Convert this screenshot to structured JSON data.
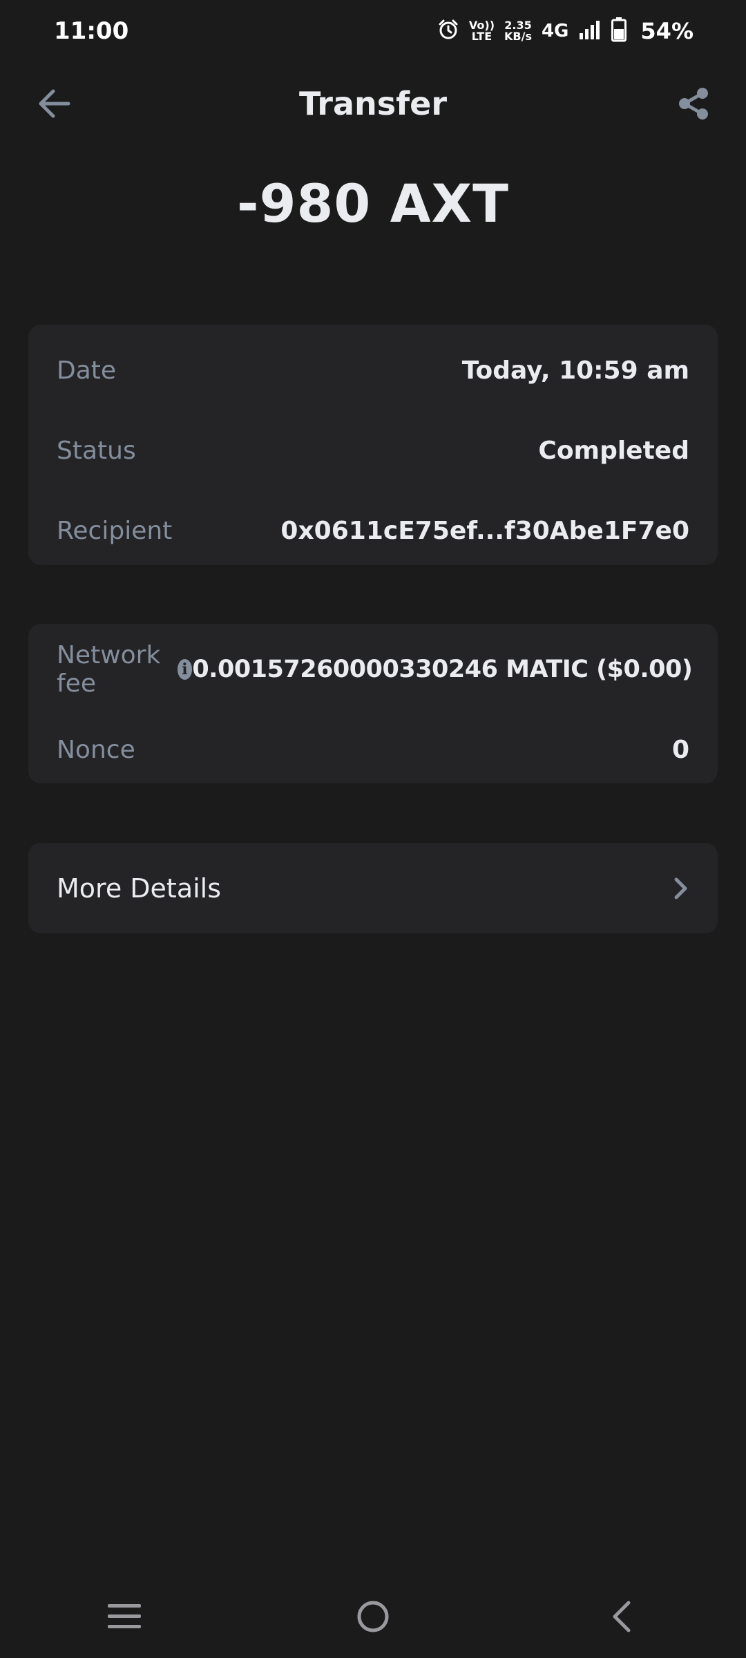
{
  "status_bar": {
    "time": "11:00",
    "volte_top": "Vo))",
    "volte_bottom": "LTE",
    "speed_top": "2.35",
    "speed_bottom": "KB/s",
    "network": "4G",
    "battery_percent": "54%",
    "icons": [
      "alarm-icon",
      "signal-icon",
      "battery-icon"
    ]
  },
  "header": {
    "title": "Transfer",
    "back_icon": "arrow-left-icon",
    "share_icon": "share-icon"
  },
  "amount": "-980 AXT",
  "details": [
    {
      "label": "Date",
      "value": "Today, 10:59 am"
    },
    {
      "label": "Status",
      "value": "Completed"
    },
    {
      "label": "Recipient",
      "value": "0x0611cE75ef...f30Abe1F7e0"
    }
  ],
  "fees": {
    "network_fee_label": "Network fee",
    "network_fee_value": "0.00157260000330246 MATIC ($0.00)",
    "info_icon": "i",
    "nonce_label": "Nonce",
    "nonce_value": "0"
  },
  "more_details": {
    "label": "More Details",
    "icon": "chevron-right-icon"
  },
  "nav": {
    "icons": [
      "menu-icon",
      "home-circle-icon",
      "back-chevron-icon"
    ]
  },
  "colors": {
    "background": "#1b1b1c",
    "card": "#242427",
    "text_primary": "#eaecef",
    "text_secondary": "#848e9c"
  }
}
